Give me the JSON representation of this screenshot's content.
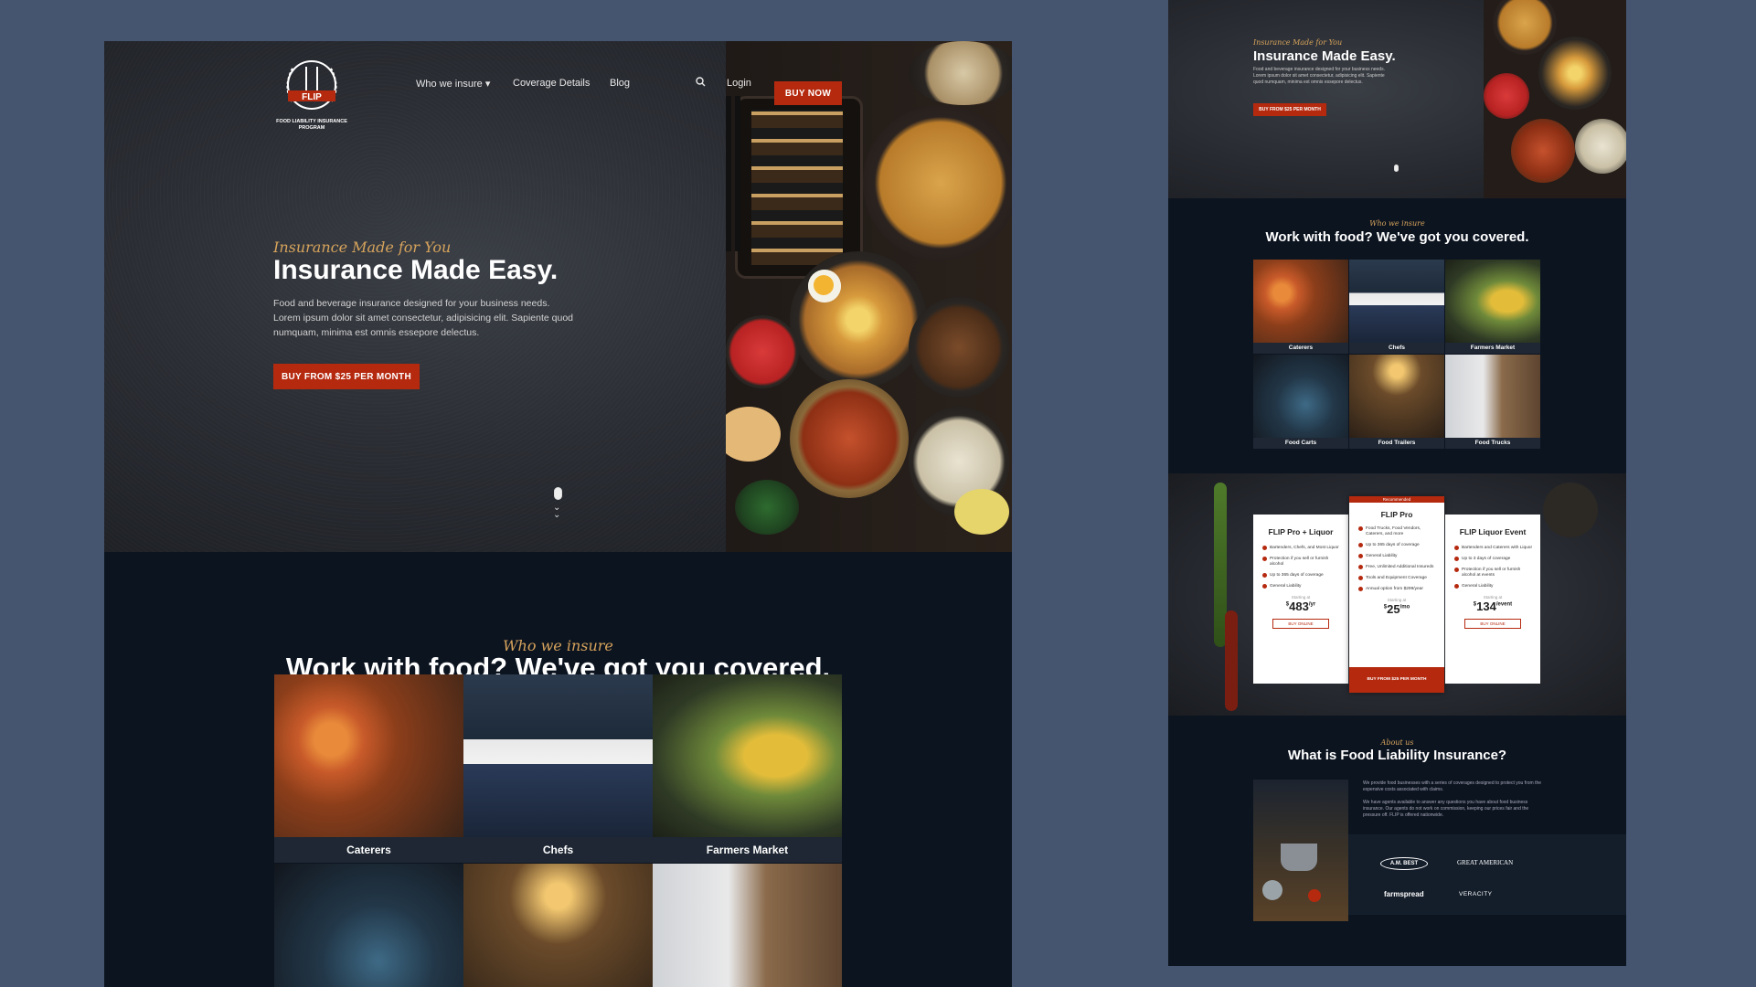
{
  "brand": {
    "logo_text": "FLIP",
    "logo_sub": "FOOD LIABILITY INSURANCE PROGRAM"
  },
  "nav": {
    "who_we_insure": "Who we insure",
    "coverage": "Coverage Details",
    "blog": "Blog",
    "login": "Login",
    "buy_now": "BUY NOW"
  },
  "hero": {
    "script": "Insurance Made for You",
    "title": "Insurance Made Easy.",
    "description": "Food and beverage insurance designed for your business needs. Lorem ipsum dolor sit amet consectetur, adipisicing elit. Sapiente quod numquam, minima est omnis essepore delectus.",
    "cta": "BUY FROM $25 PER MONTH"
  },
  "who": {
    "script": "Who we insure",
    "title": "Work with food? We've got you covered.",
    "tiles": [
      {
        "label": "Caterers"
      },
      {
        "label": "Chefs"
      },
      {
        "label": "Farmers Market"
      },
      {
        "label": "Food Carts"
      },
      {
        "label": "Food Trailers"
      },
      {
        "label": "Food Trucks"
      }
    ]
  },
  "pricing": {
    "badge": "Recommended",
    "plans": [
      {
        "name": "FLIP Pro + Liquor",
        "features": [
          "Bartenders, Chefs, and Most Liquor",
          "Protection if you sell or furnish alcohol",
          "Up to 365 days of coverage",
          "General Liability"
        ],
        "from": "Starting at",
        "price": "483",
        "unit": "/yr",
        "button": "BUY ONLINE"
      },
      {
        "name": "FLIP Pro",
        "features": [
          "Food Trucks, Food Vendors, Caterers, and more",
          "Up to 365 days of coverage",
          "General Liability",
          "Free, Unlimited Additional Insureds",
          "Tools and Equipment Coverage",
          "Annual option from $299/year"
        ],
        "from": "Starting at",
        "price": "25",
        "unit": "/mo",
        "button": "BUY FROM $25 PER MONTH"
      },
      {
        "name": "FLIP Liquor Event",
        "features": [
          "Bartenders and Caterers with Liquor",
          "Up to 3 days of coverage",
          "Protection if you sell or furnish alcohol at events",
          "General Liability"
        ],
        "from": "Starting at",
        "price": "134",
        "unit": "/event",
        "button": "BUY ONLINE"
      }
    ]
  },
  "about": {
    "script": "About us",
    "title": "What is Food Liability Insurance?",
    "p1": "We provide food businesses with a series of coverages designed to protect you from the expensive costs associated with claims.",
    "p2": "We have agents available to answer any questions you have about food business insurance. Our agents do not work on commission, keeping our prices fair and the pressure off. FLIP is offered nationwide.",
    "partners": [
      "A.M. BEST",
      "GREAT AMERICAN",
      "farmspread",
      "VERACITY"
    ]
  },
  "colors": {
    "accent": "#b52a0f",
    "gold": "#d6a35c",
    "dark": "#0c1420",
    "backdrop": "#455570"
  }
}
